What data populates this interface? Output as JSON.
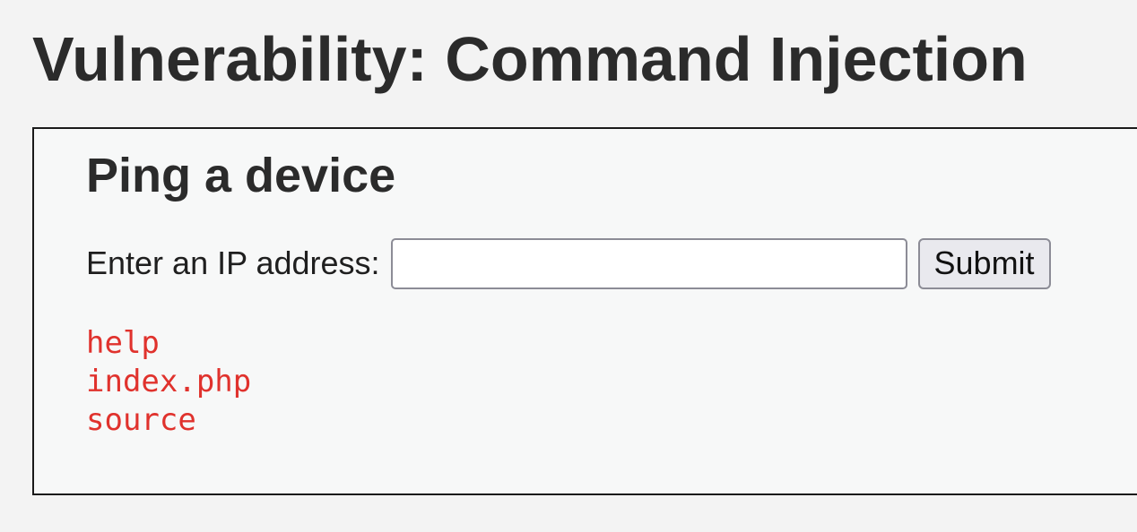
{
  "page": {
    "title": "Vulnerability: Command Injection"
  },
  "ping": {
    "title": "Ping a device",
    "ip_label": "Enter an IP address:",
    "ip_value": "",
    "submit_label": "Submit"
  },
  "output": {
    "color": "#e0322d",
    "lines": [
      "help",
      "index.php",
      "source"
    ]
  }
}
